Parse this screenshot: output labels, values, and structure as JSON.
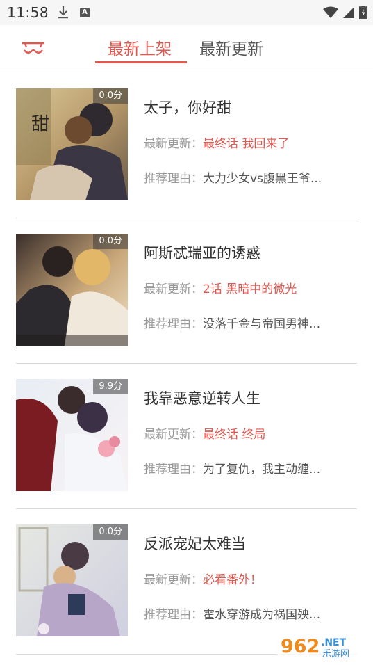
{
  "status_bar": {
    "time": "11:58",
    "a_label": "A"
  },
  "tabs": [
    {
      "label": "最新上架",
      "active": true
    },
    {
      "label": "最新更新",
      "active": false
    }
  ],
  "labels": {
    "update_prefix": "最新更新：",
    "reason_prefix": "推荐理由："
  },
  "items": [
    {
      "score": "0.0分",
      "title": "太子，你好甜",
      "update": "最终话 我回来了",
      "reason": "大力少女vs腹黑王爷..."
    },
    {
      "score": "0.0分",
      "title": "阿斯忒瑞亚的诱惑",
      "update": "2话 黑暗中的微光",
      "reason": "没落千金与帝国男神..."
    },
    {
      "score": "9.9分",
      "title": "我靠恶意逆转人生",
      "update": "最终话 终局",
      "reason": "为了复仇，我主动缠..."
    },
    {
      "score": "0.0分",
      "title": "反派宠妃太难当",
      "update": "必看番外！",
      "reason": "霍水穿游成为祸国殃..."
    }
  ],
  "watermark": {
    "text_big": "962",
    "text_net": ".NET",
    "text_sub": "乐游网"
  },
  "colors": {
    "accent": "#e0584f",
    "muted": "#999999",
    "text": "#333333"
  }
}
